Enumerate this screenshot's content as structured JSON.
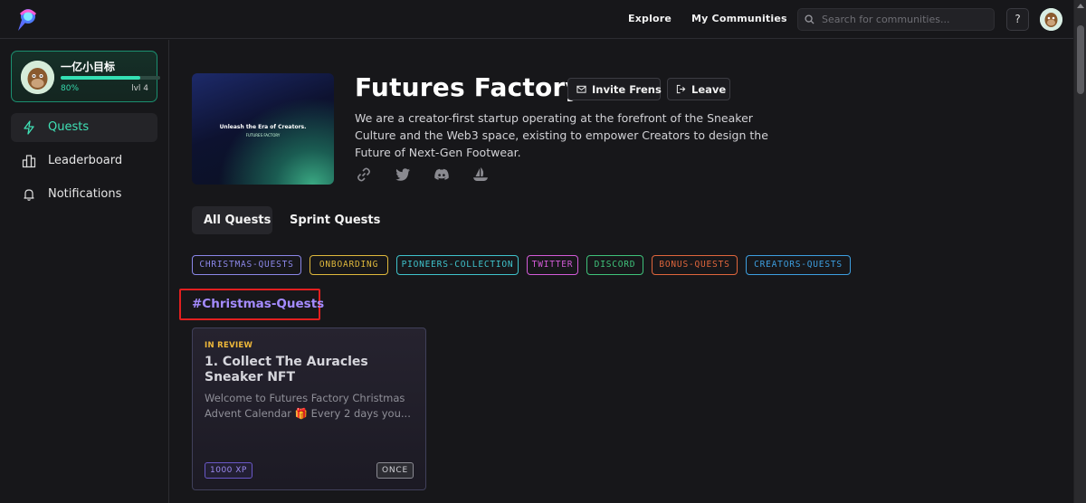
{
  "header": {
    "nav": [
      {
        "label": "Explore"
      },
      {
        "label": "My Communities"
      }
    ],
    "search": {
      "placeholder": "Search for communities..."
    },
    "help_label": "?"
  },
  "sidebar": {
    "profile": {
      "name": "一亿小目标",
      "progress": 0.8,
      "progress_label": "80%",
      "level": "lvl 4"
    },
    "items": [
      {
        "label": "Quests",
        "icon": "lightning-icon",
        "active": true
      },
      {
        "label": "Leaderboard",
        "icon": "leaderboard-icon",
        "active": false
      },
      {
        "label": "Notifications",
        "icon": "bell-icon",
        "active": false
      }
    ]
  },
  "community": {
    "banner": {
      "text": "Unleash the Era of Creators.",
      "sub": "FUTURES FACTORY"
    },
    "title": "Futures Factory",
    "invite_label": "Invite Frens",
    "leave_label": "Leave",
    "description": "We are a creator-first startup operating at the forefront of the Sneaker Culture and the Web3 space, existing to empower Creators to design the Future of Next-Gen Footwear.",
    "socials": [
      "link-icon",
      "twitter-icon",
      "discord-icon",
      "opensea-icon"
    ]
  },
  "tabs": [
    {
      "label": "All Quests",
      "active": true
    },
    {
      "label": "Sprint Quests",
      "active": false
    }
  ],
  "tags": [
    {
      "label": "CHRISTMAS-QUESTS",
      "color": "#8b87e8"
    },
    {
      "label": "ONBOARDING",
      "color": "#e0b93c"
    },
    {
      "label": "PIONEERS-COLLECTION",
      "color": "#3fc3cc"
    },
    {
      "label": "TWITTER",
      "color": "#d35bd8"
    },
    {
      "label": "DISCORD",
      "color": "#3fc27a"
    },
    {
      "label": "BONUS-QUESTS",
      "color": "#e0663c"
    },
    {
      "label": "CREATORS-QUESTS",
      "color": "#3d9fe0"
    }
  ],
  "section": {
    "title": "#Christmas-Quests"
  },
  "quest": {
    "status": "IN REVIEW",
    "title": "1. Collect The Auracles Sneaker NFT",
    "description": "Welcome to Futures Factory Christmas Advent Calendar 🎁 Every 2 days you...",
    "xp": "1000 XP",
    "frequency": "ONCE"
  },
  "colors": {
    "accent": "#34e0b4",
    "section_title": "#a48bff",
    "highlight": "#e21f1f",
    "status_review": "#f0b93a"
  }
}
